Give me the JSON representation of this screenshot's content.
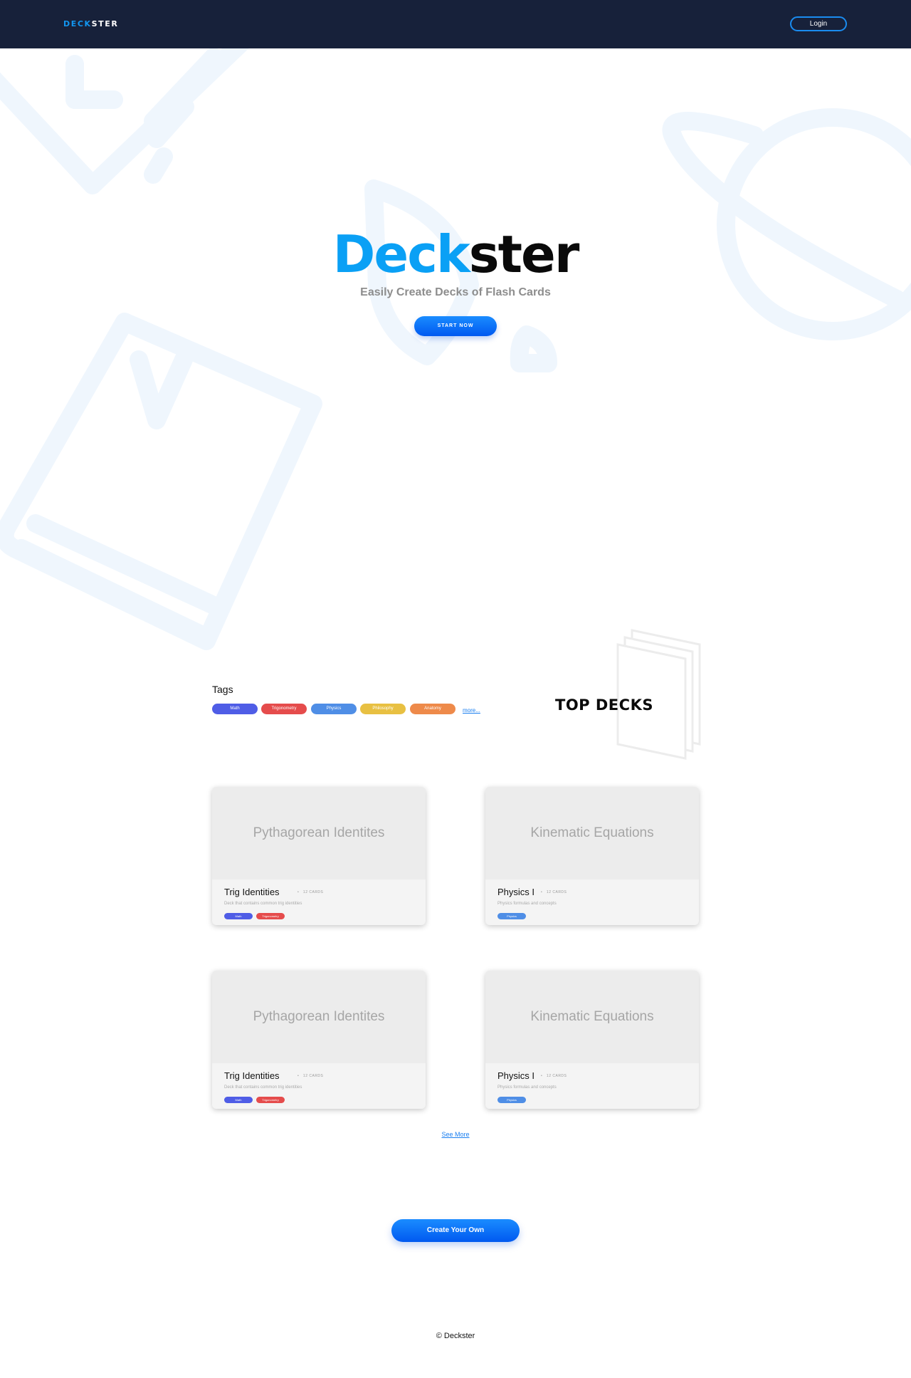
{
  "navbar": {
    "brand_a": "DECK",
    "brand_b": "STER",
    "login_label": "Login"
  },
  "hero": {
    "title_a": "Deck",
    "title_b": "ster",
    "subtitle": "Easily Create Decks of Flash Cards",
    "cta_label": "START NOW"
  },
  "tags": {
    "heading": "Tags",
    "items": [
      {
        "label": "Math",
        "color": "#4f5de6"
      },
      {
        "label": "Trigonometry",
        "color": "#e54c4c"
      },
      {
        "label": "Physics",
        "color": "#4f8ee6"
      },
      {
        "label": "Philosophy",
        "color": "#e8c042"
      },
      {
        "label": "Anatomy",
        "color": "#ee8a4a"
      }
    ],
    "more_label": "more..."
  },
  "top_decks": {
    "heading": "TOP DECKS",
    "cards": [
      {
        "cover": "Pythagorean Identites",
        "title": "Trig Identities",
        "count": "12 CARDS",
        "desc": "Deck that contains common trig identities",
        "tags": [
          {
            "label": "Math",
            "color": "#4f5de6"
          },
          {
            "label": "Trigonometry",
            "color": "#e54c4c"
          }
        ]
      },
      {
        "cover": "Kinematic Equations",
        "title": "Physics I",
        "count": "12 CARDS",
        "desc": "Physics formulas and concepts",
        "tags": [
          {
            "label": "Physics",
            "color": "#4f8ee6"
          }
        ]
      },
      {
        "cover": "Pythagorean Identites",
        "title": "Trig Identities",
        "count": "12 CARDS",
        "desc": "Deck that contains common trig identities",
        "tags": [
          {
            "label": "Math",
            "color": "#4f5de6"
          },
          {
            "label": "Trigonometry",
            "color": "#e54c4c"
          }
        ]
      },
      {
        "cover": "Kinematic Equations",
        "title": "Physics I",
        "count": "12 CARDS",
        "desc": "Physics formulas and concepts",
        "tags": [
          {
            "label": "Physics",
            "color": "#4f8ee6"
          }
        ]
      }
    ],
    "see_more_label": "See More"
  },
  "create_label": "Create Your Own",
  "footer": "© Deckster",
  "colors": {
    "navbar_bg": "#17213a",
    "accent": "#0aa0f5",
    "button": "#0a6cf5"
  }
}
